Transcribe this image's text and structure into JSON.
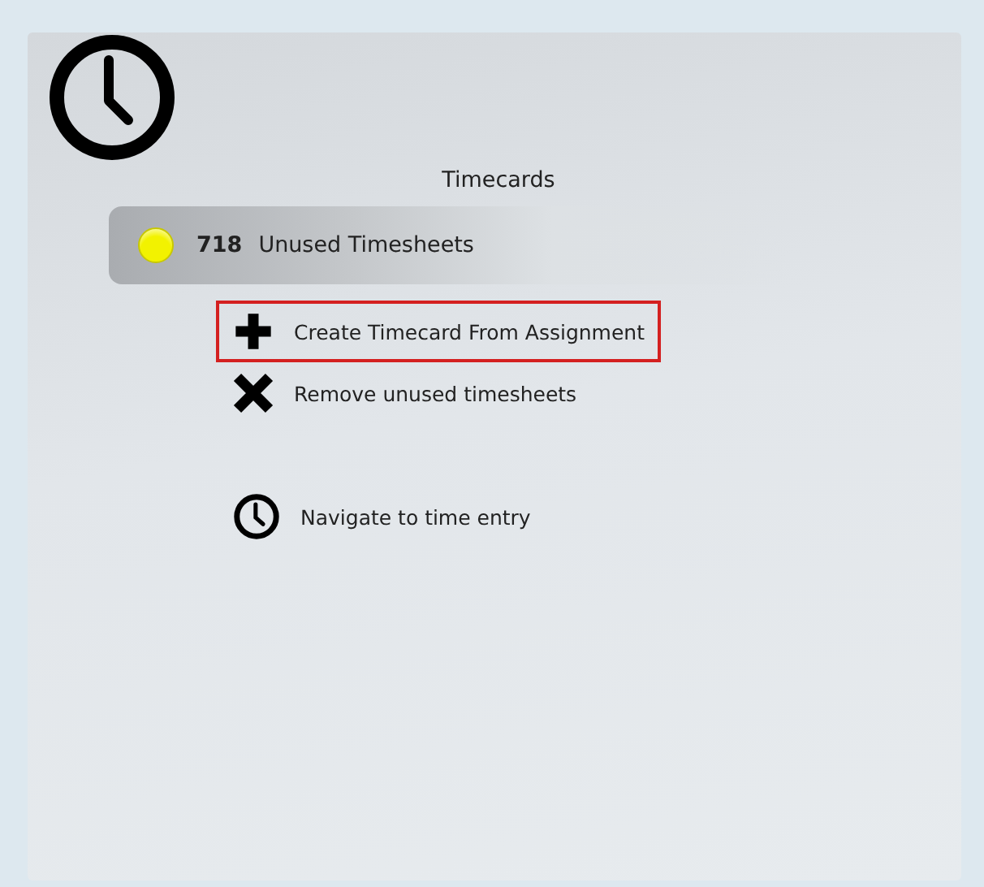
{
  "title": "Timecards",
  "status": {
    "count": "718",
    "label": "Unused Timesheets",
    "color": "#f2f200"
  },
  "action_groups": [
    [
      {
        "kind": "plus",
        "label": "Create Timecard From Assignment",
        "selected": true
      },
      {
        "kind": "cross",
        "label": "Remove unused timesheets",
        "selected": false
      }
    ],
    [
      {
        "kind": "clock",
        "label": "Navigate to time entry",
        "selected": false
      }
    ]
  ]
}
